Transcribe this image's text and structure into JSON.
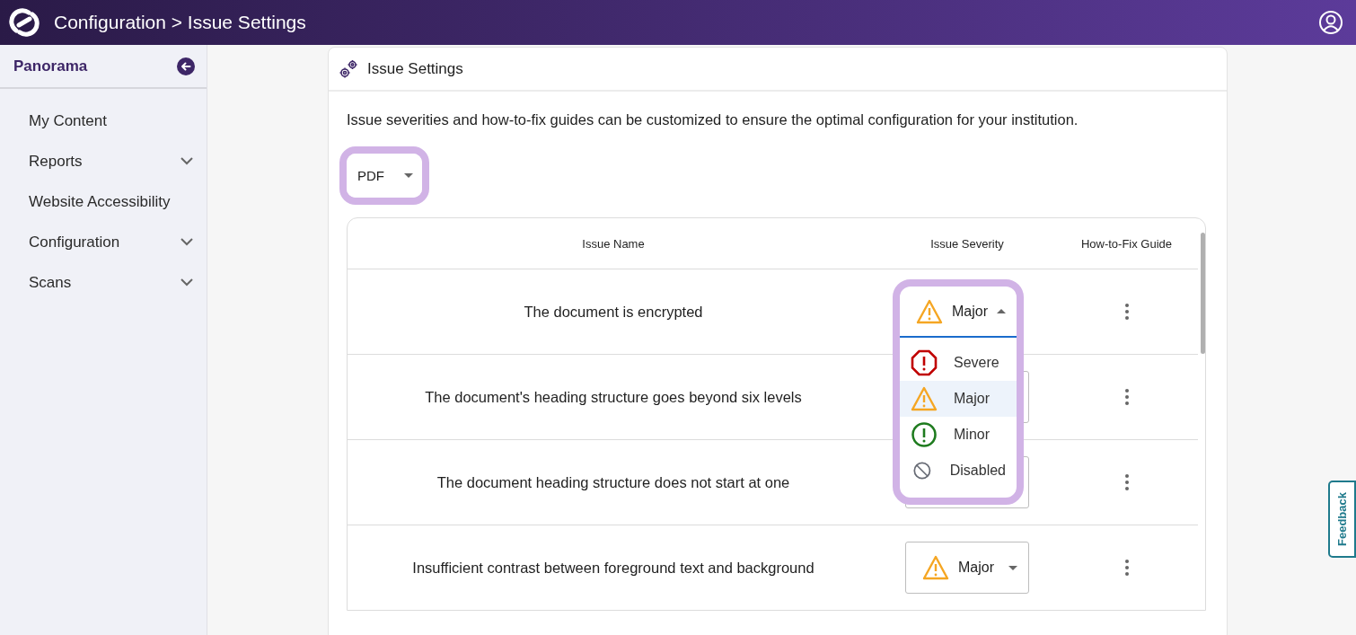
{
  "header": {
    "title": "Configuration > Issue Settings"
  },
  "sidebar": {
    "title": "Panorama",
    "items": [
      {
        "label": "My Content",
        "expandable": false
      },
      {
        "label": "Reports",
        "expandable": true
      },
      {
        "label": "Website Accessibility",
        "expandable": false
      },
      {
        "label": "Configuration",
        "expandable": true
      },
      {
        "label": "Scans",
        "expandable": true
      }
    ]
  },
  "card": {
    "title": "Issue Settings",
    "description": "Issue severities and how-to-fix guides can be customized to ensure the optimal configuration for your institution.",
    "file_type": {
      "value": "PDF"
    },
    "table": {
      "columns": [
        "Issue Name",
        "Issue Severity",
        "How-to-Fix Guide"
      ],
      "rows": [
        {
          "name": "The document is encrypted",
          "severity": {
            "kind": "major",
            "label": "Major"
          },
          "expanded": true
        },
        {
          "name": "The document's heading structure goes beyond six levels",
          "expanded": false
        },
        {
          "name": "The document heading structure does not start at one",
          "expanded": false
        },
        {
          "name": "Insufficient contrast between foreground text and background",
          "severity": {
            "kind": "major",
            "label": "Major"
          },
          "expanded": false
        }
      ]
    },
    "severity_options": [
      {
        "kind": "severe",
        "label": "Severe",
        "selected": false
      },
      {
        "kind": "major",
        "label": "Major",
        "selected": true
      },
      {
        "kind": "minor",
        "label": "Minor",
        "selected": false
      },
      {
        "kind": "disabled",
        "label": "Disabled",
        "selected": false
      }
    ]
  },
  "feedback": {
    "label": "Feedback"
  }
}
